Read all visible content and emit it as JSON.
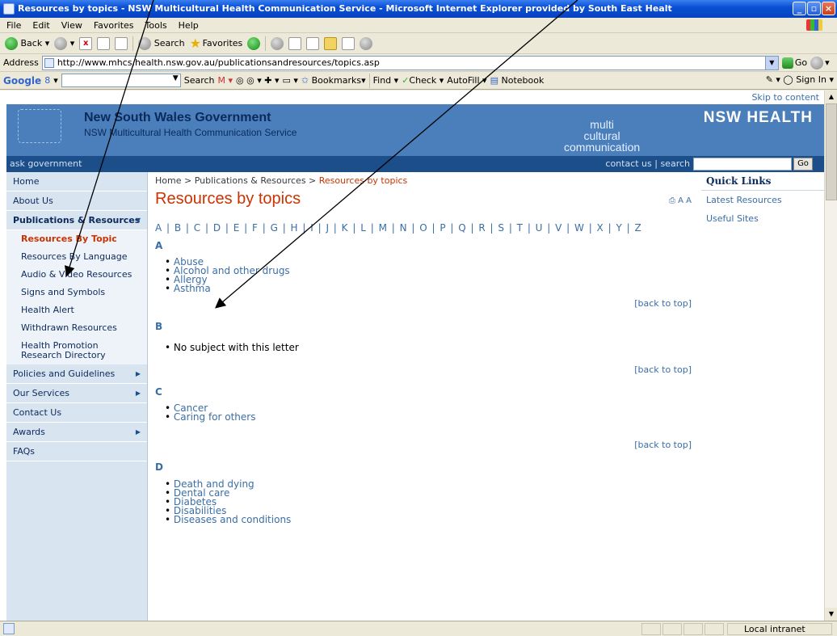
{
  "window": {
    "title": "Resources by topics - NSW Multicultural Health Communication Service - Microsoft Internet Explorer provided by South East Healt"
  },
  "menu": [
    "File",
    "Edit",
    "View",
    "Favorites",
    "Tools",
    "Help"
  ],
  "toolbar": {
    "back_label": "Back",
    "search_label": "Search",
    "favorites_label": "Favorites"
  },
  "address": {
    "label": "Address",
    "url": "http://www.mhcs.health.nsw.gov.au/publicationsandresources/topics.asp",
    "go_label": "Go"
  },
  "googlebar": {
    "logo": "Google",
    "box_value": "8",
    "search_label": "Search",
    "bookmarks_label": "Bookmarks",
    "find_label": "Find",
    "check_label": "Check",
    "autofill_label": "AutoFill",
    "notebook_label": "Notebook",
    "signin_label": "Sign In"
  },
  "site": {
    "skip_link": "Skip to content",
    "gov_name": "New South Wales Government",
    "service_name": "NSW Multicultural Health Communication Service",
    "mc_logo_line1": "multi",
    "mc_logo_line2": "cultural",
    "mc_logo_line3": "communication",
    "nsw_health": "NSW HEALTH",
    "ask_gov": "ask government",
    "contact_search": "contact us | search",
    "search_go": "Go"
  },
  "nav": {
    "home": "Home",
    "about": "About Us",
    "pubs": "Publications & Resources",
    "subs": [
      "Resources By Topic",
      "Resources By Language",
      "Audio & Video Resources",
      "Signs and Symbols",
      "Health Alert",
      "Withdrawn Resources",
      "Health Promotion Research Directory"
    ],
    "policies": "Policies and Guidelines",
    "services": "Our Services",
    "contact": "Contact Us",
    "awards": "Awards",
    "faqs": "FAQs"
  },
  "main": {
    "crumb_home": "Home",
    "crumb_pubs": "Publications & Resources",
    "crumb_current": "Resources by topics",
    "crumb_sep": ">",
    "title": "Resources by topics",
    "print_icons": "A A",
    "alphabet": "A | B | C | D | E | F | G | H | I | J | K | L | M | N | O | P | Q | R | S | T | U | V | W | X | Y | Z",
    "back_to_top": "[back to top]",
    "section_a": {
      "letter": "A",
      "topics": [
        "Abuse",
        "Alcohol and other drugs",
        "Allergy",
        "Asthma"
      ]
    },
    "section_b": {
      "letter": "B",
      "note": "No subject with this letter"
    },
    "section_c": {
      "letter": "C",
      "topics": [
        "Cancer",
        "Caring for others"
      ]
    },
    "section_d": {
      "letter": "D",
      "topics": [
        "Death and dying",
        "Dental care",
        "Diabetes",
        "Disabilities",
        "Diseases and conditions"
      ]
    }
  },
  "quick": {
    "heading": "Quick Links",
    "links": [
      "Latest Resources",
      "Useful Sites"
    ]
  },
  "status": {
    "zone": "Local intranet"
  }
}
